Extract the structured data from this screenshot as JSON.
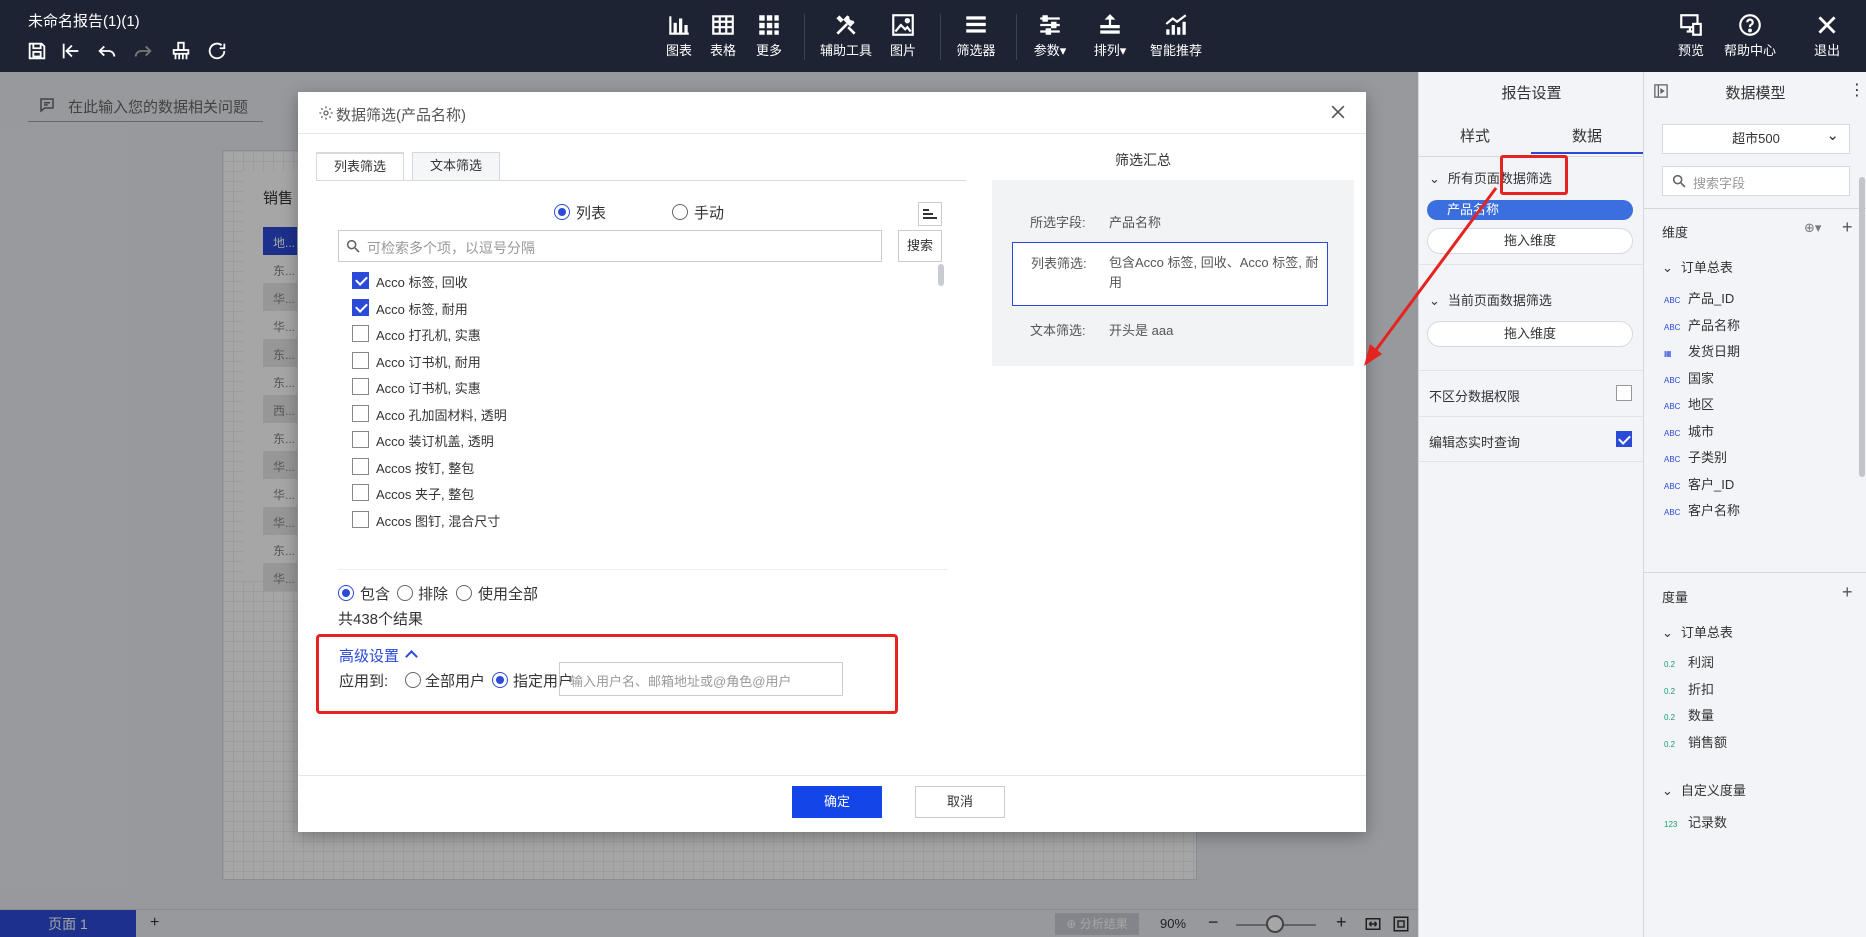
{
  "app": {
    "title": "未命名报告(1)(1)"
  },
  "toolbar": {
    "chart": "图表",
    "table": "表格",
    "more": "更多",
    "tools": "辅助工具",
    "image": "图片",
    "filter": "筛选器",
    "params": "参数",
    "arrange": "排列",
    "smart": "智能推荐",
    "preview": "预览",
    "help": "帮助中心",
    "exit": "退出"
  },
  "canvas": {
    "question_placeholder": "在此输入您的数据相关问题",
    "card_title": "销售",
    "rows": [
      "地...",
      "东...",
      "华...",
      "华...",
      "东...",
      "东...",
      "西...",
      "东...",
      "华...",
      "华...",
      "华...",
      "东...",
      "华..."
    ]
  },
  "bottombar": {
    "page_tab": "页面 1",
    "add": "+",
    "analysis": "分析结果",
    "zoom": "90%"
  },
  "settings": {
    "title": "报告设置",
    "tab_style": "样式",
    "tab_data": "数据",
    "all_pages_filter": "所有页面数据筛选",
    "field_pill": "产品名称",
    "drag_dimension": "拖入维度",
    "current_page_filter": "当前页面数据筛选",
    "drag_dimension_2": "拖入维度",
    "no_permission": "不区分数据权限",
    "no_permission_checked": false,
    "edit_realtime": "编辑态实时查询",
    "edit_realtime_checked": true
  },
  "model": {
    "title": "数据模型",
    "dataset": "超市500",
    "search_placeholder": "搜索字段",
    "dimensions_label": "维度",
    "dim_group": "订单总表",
    "dimensions": [
      {
        "type": "ABC",
        "name": "产品_ID"
      },
      {
        "type": "ABC",
        "name": "产品名称"
      },
      {
        "type": "date",
        "name": "发货日期"
      },
      {
        "type": "ABC",
        "name": "国家"
      },
      {
        "type": "ABC",
        "name": "地区"
      },
      {
        "type": "ABC",
        "name": "城市"
      },
      {
        "type": "ABC",
        "name": "子类别"
      },
      {
        "type": "ABC",
        "name": "客户_ID"
      },
      {
        "type": "ABC",
        "name": "客户名称"
      }
    ],
    "measures_label": "度量",
    "measure_group": "订单总表",
    "measures": [
      {
        "type": "0.2",
        "name": "利润"
      },
      {
        "type": "0.2",
        "name": "折扣"
      },
      {
        "type": "0.2",
        "name": "数量"
      },
      {
        "type": "0.2",
        "name": "销售额"
      }
    ],
    "custom_group": "自定义度量",
    "custom_measures": [
      {
        "type": "123",
        "name": "记录数"
      }
    ]
  },
  "dialog": {
    "title": "数据筛选(产品名称)",
    "tab_list": "列表筛选",
    "tab_text": "文本筛选",
    "mode_list": "列表",
    "mode_manual": "手动",
    "search_placeholder": "可检索多个项，以逗号分隔",
    "search_button": "搜索",
    "items": [
      {
        "label": "Acco 标签, 回收",
        "checked": true
      },
      {
        "label": "Acco 标签, 耐用",
        "checked": true
      },
      {
        "label": "Acco 打孔机, 实惠",
        "checked": false
      },
      {
        "label": "Acco 订书机, 耐用",
        "checked": false
      },
      {
        "label": "Acco 订书机, 实惠",
        "checked": false
      },
      {
        "label": "Acco 孔加固材料, 透明",
        "checked": false
      },
      {
        "label": "Acco 装订机盖, 透明",
        "checked": false
      },
      {
        "label": "Accos 按钉, 整包",
        "checked": false
      },
      {
        "label": "Accos 夹子, 整包",
        "checked": false
      },
      {
        "label": "Accos 图钉, 混合尺寸",
        "checked": false
      }
    ],
    "include": "包含",
    "exclude": "排除",
    "use_all": "使用全部",
    "result_count": "共438个结果",
    "advanced": "高级设置",
    "apply_to": "应用到:",
    "all_users": "全部用户",
    "specific_users": "指定用户",
    "user_placeholder": "输入用户名、邮箱地址或@角色@用户",
    "summary_title": "筛选汇总",
    "summary": {
      "field_key": "所选字段:",
      "field_val": "产品名称",
      "list_key": "列表筛选:",
      "list_val": "包含Acco 标签, 回收、Acco 标签, 耐用",
      "text_key": "文本筛选:",
      "text_val": "开头是 aaa"
    },
    "ok": "确定",
    "cancel": "取消"
  }
}
